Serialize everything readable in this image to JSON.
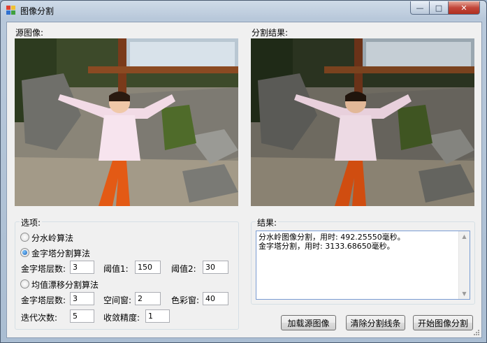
{
  "window": {
    "title": "图像分割",
    "minimize_glyph": "—",
    "maximize_glyph": "□",
    "close_glyph": "✕"
  },
  "source_panel": {
    "label": "源图像:"
  },
  "result_panel": {
    "label": "分割结果:"
  },
  "options": {
    "title": "选项:",
    "watershed": {
      "label": "分水岭算法",
      "checked": false
    },
    "pyramid": {
      "label": "金字塔分割算法",
      "checked": true,
      "levels_label": "金字塔层数:",
      "levels_value": "3",
      "threshold1_label": "阈值1:",
      "threshold1_value": "150",
      "threshold2_label": "阈值2:",
      "threshold2_value": "30"
    },
    "meanshift": {
      "label": "均值漂移分割算法",
      "checked": false,
      "levels_label": "金字塔层数:",
      "levels_value": "3",
      "spatial_label": "空间窗:",
      "spatial_value": "2",
      "color_label": "色彩窗:",
      "color_value": "40",
      "iterations_label": "迭代次数:",
      "iterations_value": "5",
      "epsilon_label": "收敛精度:",
      "epsilon_value": "1"
    }
  },
  "results": {
    "title": "结果:",
    "text": "分水岭图像分割，用时: 492.25550毫秒。\n金字塔分割，用时: 3133.68650毫秒。"
  },
  "buttons": {
    "load": "加载源图像",
    "clear": "清除分割线条",
    "start": "开始图像分割"
  },
  "colors": {
    "title_bar": "#b8c8da",
    "client_bg": "#f0f0f0",
    "close_button": "#c2463a",
    "radio_selected": "#1a5fb4"
  }
}
